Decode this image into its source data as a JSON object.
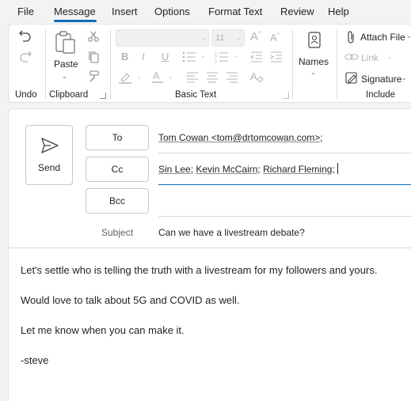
{
  "menu": {
    "items": [
      "File",
      "Message",
      "Insert",
      "Options",
      "Format Text",
      "Review",
      "Help"
    ],
    "active": "Message"
  },
  "ribbon": {
    "groups": {
      "undo": "Undo",
      "clipboard": "Clipboard",
      "basic_text": "Basic Text",
      "names": "Names",
      "include": "Include"
    },
    "paste_label": "Paste",
    "font_size": "11",
    "names_label": "Names",
    "attach_file": "Attach File",
    "link": "Link",
    "signature": "Signature",
    "bold": "B",
    "italic": "I",
    "underline": "U"
  },
  "compose": {
    "send_label": "Send",
    "to_label": "To",
    "cc_label": "Cc",
    "bcc_label": "Bcc",
    "subject_label": "Subject",
    "to_recipients": [
      "Tom Cowan <tom@drtomcowan.com>"
    ],
    "cc_recipients": [
      "Sin Lee",
      "Kevin McCairn",
      "Richard Fleming"
    ],
    "bcc_value": "",
    "subject": "Can we have a livestream debate?",
    "body_lines": [
      "Let's settle who is telling the truth with a livestream for my followers and yours.",
      "Would love to talk about 5G and COVID as well.",
      "Let me know when you can make it.",
      "-steve"
    ]
  }
}
